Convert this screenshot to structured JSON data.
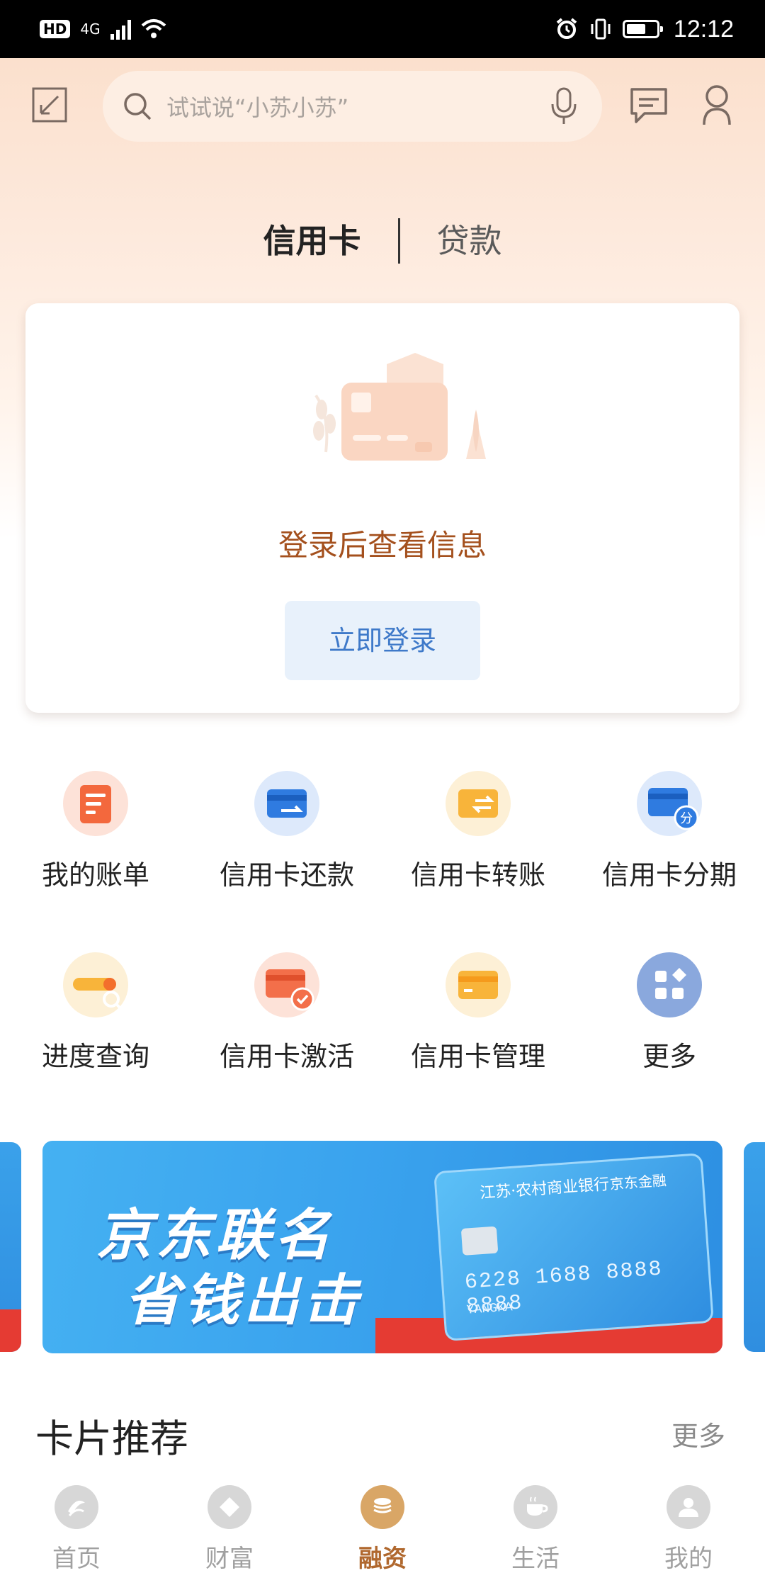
{
  "status_bar": {
    "hd_badge": "HD",
    "network": "4G",
    "time": "12:12"
  },
  "header": {
    "search_placeholder": "试试说“小苏小苏”"
  },
  "tabs": [
    {
      "label": "信用卡",
      "active": true
    },
    {
      "label": "贷款",
      "active": false
    }
  ],
  "login_card": {
    "hint": "登录后查看信息",
    "button_label": "立即登录"
  },
  "functions": [
    {
      "label": "我的账单",
      "icon": "bill-icon"
    },
    {
      "label": "信用卡还款",
      "icon": "card-repay-icon"
    },
    {
      "label": "信用卡转账",
      "icon": "card-transfer-icon"
    },
    {
      "label": "信用卡分期",
      "icon": "card-installment-icon",
      "badge": "分"
    },
    {
      "label": "进度查询",
      "icon": "progress-search-icon"
    },
    {
      "label": "信用卡激活",
      "icon": "card-activate-icon"
    },
    {
      "label": "信用卡管理",
      "icon": "card-manage-icon"
    },
    {
      "label": "更多",
      "icon": "more-apps-icon"
    }
  ],
  "banner": {
    "line1": "京东联名",
    "line2": "省钱出击",
    "card_bank_name": "江苏·农村商业银行",
    "card_brand": "京东金融",
    "card_number": "6228 1688 8888 8888",
    "card_holder": "YANGKA"
  },
  "section": {
    "title": "卡片推荐",
    "more_label": "更多"
  },
  "bottom_nav": [
    {
      "label": "首页",
      "icon": "home-icon",
      "active": false
    },
    {
      "label": "财富",
      "icon": "wealth-icon",
      "active": false
    },
    {
      "label": "融资",
      "icon": "financing-icon",
      "active": true
    },
    {
      "label": "生活",
      "icon": "life-icon",
      "active": false
    },
    {
      "label": "我的",
      "icon": "profile-icon",
      "active": false
    }
  ],
  "colors": {
    "accent_brown": "#a4501d",
    "login_blue": "#3e79c9",
    "nav_active": "#b0682e"
  }
}
